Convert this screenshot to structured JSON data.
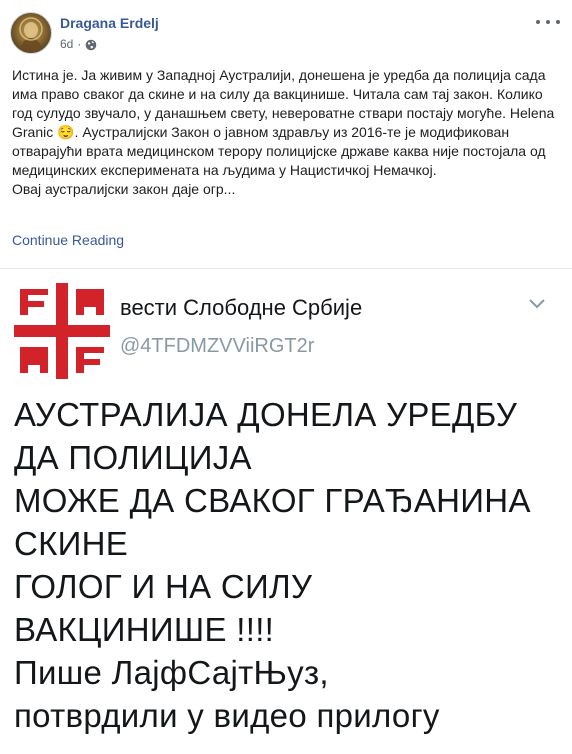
{
  "post": {
    "author": "Dragana Erdelj",
    "timestamp": "6d",
    "separator": "·",
    "privacy_icon": "globe-icon",
    "more_icon": "more-horizontal-icon",
    "text": "Истина је. Ја живим у Западној Аустралији, донешена је уредба да полиција сада има право сваког да скине и на силу да вакцинише. Читала сам тај закон. Колико год сулудо звучало, у данашњем свету, невероватне ствари постају могуће. Helena Granic 😌. Аустралијски Закон о јавном здрављу из 2016-те је модификован отварајући врата медицинском терору полицијске државе каква није постојала од медицинских експеримената на људима у Нацистичкој Немачкој.\nОвај аустралијски закон даје огр...",
    "continue_label": "Continue Reading"
  },
  "tweet": {
    "logo_icon": "serbian-cross-logo",
    "account_name": "вести Слободне Србије",
    "handle": "@4TFDMZVViiRGT2r",
    "caret_icon": "chevron-down-icon",
    "body": "АУСТРАЛИЈА ДОНЕЛА УРЕДБУ\nДА ПОЛИЦИЈА\nМОЖЕ ДА СВАКОГ ГРАЂАНИНА\nСКИНЕ\nГОЛОГ И НА СИЛУ\nВАКЦИНИШЕ !!!!\nПише ЛајфСајтЊуз,\nпотврдили у видео прилогу"
  },
  "colors": {
    "link": "#385898",
    "text": "#1c1e21",
    "meta": "#616770",
    "logo_red": "#d2232a",
    "handle": "#8899a6"
  }
}
